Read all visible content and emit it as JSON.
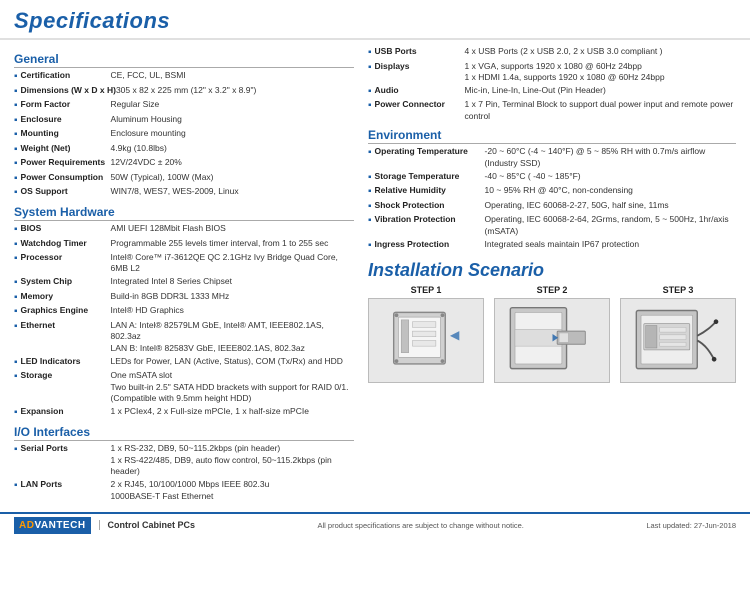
{
  "header": {
    "title": "Specifications"
  },
  "footer": {
    "brand": "AD",
    "brand_highlight": "VANTECH",
    "product_category": "Control Cabinet PCs",
    "notice": "All product specifications are subject to change without notice.",
    "date": "Last updated: 27-Jun-2018"
  },
  "left_column": {
    "sections": [
      {
        "title": "General",
        "items": [
          {
            "label": "Certification",
            "value": "CE, FCC, UL, BSMI"
          },
          {
            "label": "Dimensions (W x D x H)",
            "value": "305 x 82 x 225 mm (12\" x 3.2\" x 8.9\")"
          },
          {
            "label": "Form Factor",
            "value": "Regular Size"
          },
          {
            "label": "Enclosure",
            "value": "Aluminum Housing"
          },
          {
            "label": "Mounting",
            "value": "Enclosure mounting"
          },
          {
            "label": "Weight (Net)",
            "value": "4.9kg (10.8lbs)"
          },
          {
            "label": "Power Requirements",
            "value": "12V/24VDC ± 20%"
          },
          {
            "label": "Power Consumption",
            "value": "50W (Typical), 100W (Max)"
          },
          {
            "label": "OS Support",
            "value": "WIN7/8, WES7, WES-2009, Linux"
          }
        ]
      },
      {
        "title": "System Hardware",
        "items": [
          {
            "label": "BIOS",
            "value": "AMI UEFI 128Mbit Flash BIOS"
          },
          {
            "label": "Watchdog Timer",
            "value": "Programmable 255 levels timer interval, from 1 to 255 sec"
          },
          {
            "label": "Processor",
            "value": "Intel® Core™ i7-3612QE QC 2.1GHz Ivy Bridge Quad Core, 6MB L2"
          },
          {
            "label": "System Chip",
            "value": "Integrated Intel 8 Series Chipset"
          },
          {
            "label": "Memory",
            "value": "Build-in 8GB DDR3L 1333 MHz"
          },
          {
            "label": "Graphics Engine",
            "value": "Intel® HD Graphics"
          },
          {
            "label": "Ethernet",
            "value": "LAN A: Intel® 82579LM GbE, Intel® AMT, IEEE802.1AS, 802.3az\nLAN B: Intel® 82583V GbE, IEEE802.1AS, 802.3az"
          },
          {
            "label": "LED Indicators",
            "value": "LEDs for Power, LAN (Active, Status), COM (Tx/Rx) and HDD"
          },
          {
            "label": "Storage",
            "value": "One mSATA slot\nTwo built-in 2.5\" SATA HDD brackets with support for RAID 0/1. (Compatible with 9.5mm height HDD)"
          },
          {
            "label": "Expansion",
            "value": "1 x PCIex4, 2 x Full-size mPCIe, 1 x half-size mPCIe"
          }
        ]
      },
      {
        "title": "I/O Interfaces",
        "items": [
          {
            "label": "Serial Ports",
            "value": "1 x RS-232, DB9, 50~115.2kbps (pin header)\n1 x RS-422/485, DB9, auto flow control, 50~115.2kbps (pin header)"
          },
          {
            "label": "LAN Ports",
            "value": "2 x RJ45, 10/100/1000 Mbps IEEE 802.3u\n1000BASE-T Fast Ethernet"
          }
        ]
      }
    ]
  },
  "right_column": {
    "io_items": [
      {
        "label": "USB Ports",
        "value": "4 x USB Ports (2 x USB 2.0, 2 x USB 3.0 compliant )"
      },
      {
        "label": "Displays",
        "value": "1 x VGA, supports 1920 x 1080 @ 60Hz 24bpp\n1 x HDMI 1.4a, supports 1920 x 1080 @ 60Hz 24bpp"
      },
      {
        "label": "Audio",
        "value": "Mic-in, Line-In, Line-Out (Pin Header)"
      },
      {
        "label": "Power Connector",
        "value": "1 x 7 Pin, Terminal Block to support dual power input and remote power control"
      }
    ],
    "environment": {
      "title": "Environment",
      "items": [
        {
          "label": "Operating Temperature",
          "value": "-20 ~ 60°C (-4 ~ 140°F) @ 5 ~ 85% RH with 0.7m/s airflow (Industry SSD)"
        },
        {
          "label": "Storage Temperature",
          "value": "-40 ~ 85°C ( -40 ~ 185°F)"
        },
        {
          "label": "Relative Humidity",
          "value": "10 ~ 95% RH @ 40°C, non-condensing"
        },
        {
          "label": "Shock Protection",
          "value": "Operating, IEC 60068-2-27, 50G, half sine, 11ms"
        },
        {
          "label": "Vibration Protection",
          "value": "Operating, IEC 60068-2-64, 2Grms, random, 5 ~ 500Hz, 1hr/axis (mSATA)"
        },
        {
          "label": "Ingress Protection",
          "value": "Integrated seals maintain IP67 protection"
        }
      ]
    },
    "installation": {
      "title": "Installation Scenario",
      "steps": [
        {
          "label": "STEP 1"
        },
        {
          "label": "STEP 2"
        },
        {
          "label": "STEP 3"
        }
      ]
    }
  }
}
